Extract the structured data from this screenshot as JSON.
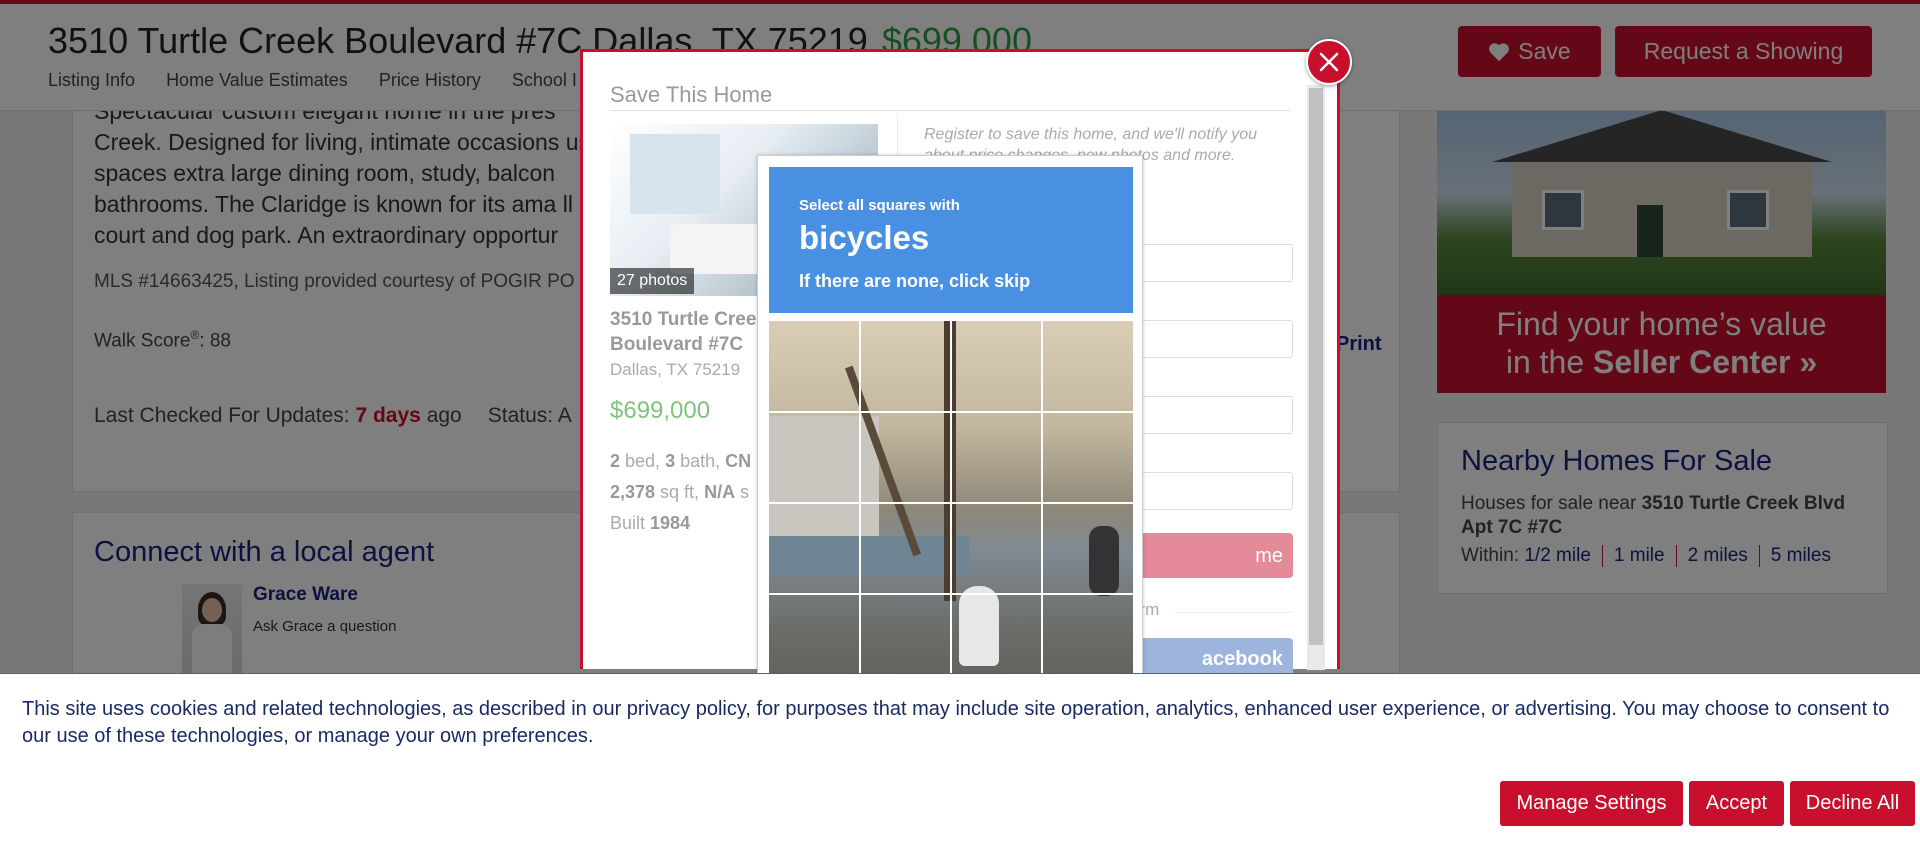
{
  "header": {
    "address": "3510 Turtle Creek Boulevard #7C Dallas, TX 75219",
    "price": "$699,000",
    "nav": [
      "Listing Info",
      "Home Value Estimates",
      "Price History",
      "School I"
    ],
    "save_label": "Save",
    "showing_label": "Request a Showing"
  },
  "listing": {
    "description": "Spectacular custom elegant home in the pres\nCreek. Designed for living, intimate occasions                                                                                                            us\nspaces extra large dining room, study, balcon\nbathrooms. The Claridge is known for its ama                                                                                                               ll\ncourt and dog park. An extraordinary opportur",
    "mls": "MLS #14663425, Listing provided courtesy of POGIR PO",
    "walk_label": "Walk Score",
    "walk_reg": "®",
    "walk_value": ": 88",
    "print": "Print",
    "checked_label": "Last Checked For Updates: ",
    "checked_value": "7 days",
    "checked_suffix": " ago",
    "status": "Status: A"
  },
  "agent": {
    "section_title": "Connect with a local agent",
    "name": "Grace Ware",
    "ask": "Ask Grace a question"
  },
  "ad": {
    "line1": "Find your home’s value",
    "line2_pre": "in the ",
    "line2_bold": "Seller Center »"
  },
  "nearby": {
    "title": "Nearby Homes For Sale",
    "text_pre": "Houses for sale near ",
    "text_bold": "3510 Turtle Creek Blvd Apt 7C #7C",
    "within_label": "Within:",
    "options": [
      "1/2 mile",
      "1 mile",
      "2 miles",
      "5 miles"
    ]
  },
  "modal": {
    "title": "Save This Home",
    "photo_count": "27 photos",
    "address": "3510 Turtle Cree\nBoulevard #7C",
    "city": "Dallas, TX 75219",
    "price": "$699,000",
    "specs": {
      "beds": "2",
      "beds_label": " bed, ",
      "baths": "3",
      "baths_label": " bath, ",
      "type": "CN",
      "sqft": "2,378",
      "sqft_label": " sq ft, ",
      "lot": "N/A",
      "lot_label": " s",
      "built_label": "Built ",
      "built": "1984"
    },
    "register_text": "Register to save this home, and we'll notify you about price changes, new photos and more.",
    "email_placeholder": "m",
    "submit_label": "me",
    "or_label": "orm",
    "facebook_label": "acebook"
  },
  "captcha": {
    "line1": "Select all squares with",
    "line2": "bicycles",
    "line3": "If there are none, click skip"
  },
  "cookie": {
    "text": "This site uses cookies and related technologies, as described in our privacy policy, for purposes that may include site operation, analytics, enhanced user experience, or advertising. You may choose to consent to our use of these technologies, or manage your own preferences.",
    "manage": "Manage Settings",
    "accept": "Accept",
    "decline": "Decline All"
  },
  "colors": {
    "brand_red": "#c8102e",
    "price_green": "#2f9e44",
    "navy": "#1a237e",
    "captcha_blue": "#4a90e2"
  },
  "icons": [
    "heart-icon",
    "close-icon"
  ]
}
